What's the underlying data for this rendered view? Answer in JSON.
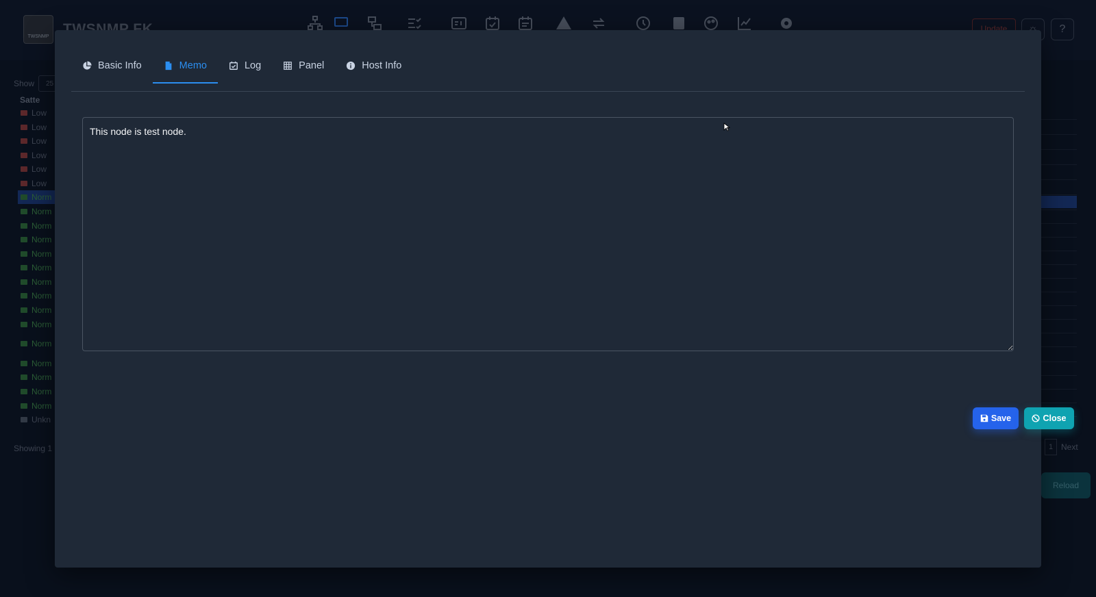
{
  "app": {
    "title": "TWSNMP FK",
    "logo_text": "TWSNMP",
    "update_label": "Update",
    "help_label": "?",
    "theme_label": "☼"
  },
  "nav_icons": [
    "network-map-icon",
    "node-list-icon",
    "lan-icon",
    "polling-list-icon",
    "address-icon",
    "event-log-icon",
    "syslog-icon",
    "alert-icon",
    "transfer-icon",
    "history-icon",
    "check-icon",
    "report-icon",
    "chart-icon",
    "settings-icon"
  ],
  "background_list": {
    "show_label": "Show",
    "show_value": "25",
    "state_header": "Satte",
    "rows": [
      {
        "label": "Low",
        "color": "#8b3a3a"
      },
      {
        "label": "Low",
        "color": "#8b3a3a"
      },
      {
        "label": "Low",
        "color": "#8b3a3a"
      },
      {
        "label": "Low",
        "color": "#8b3a3a"
      },
      {
        "label": "Low",
        "color": "#8b3a3a"
      },
      {
        "label": "Low",
        "color": "#8b3a3a"
      },
      {
        "label": "Norm",
        "color": "#2f6f3a"
      },
      {
        "label": "Norm",
        "color": "#2f6f3a"
      },
      {
        "label": "Norm",
        "color": "#2f6f3a"
      },
      {
        "label": "Norm",
        "color": "#2f6f3a"
      },
      {
        "label": "Norm",
        "color": "#2f6f3a"
      },
      {
        "label": "Norm",
        "color": "#2f6f3a"
      },
      {
        "label": "Norm",
        "color": "#2f6f3a"
      },
      {
        "label": "Norm",
        "color": "#2f6f3a"
      },
      {
        "label": "Norm",
        "color": "#2f6f3a"
      },
      {
        "label": "Norm",
        "color": "#2f6f3a"
      },
      {
        "label": "Norm",
        "color": "#2f6f3a"
      },
      {
        "label": "Norm",
        "color": "#2f6f3a"
      },
      {
        "label": "Norm",
        "color": "#2f6f3a"
      },
      {
        "label": "Norm",
        "color": "#2f6f3a"
      },
      {
        "label": "Norm",
        "color": "#2f6f3a"
      },
      {
        "label": "Unkn",
        "color": "#4b5563"
      }
    ],
    "showing_text": "Showing 1",
    "page_number": "1",
    "next_label": "Next",
    "reload_label": "Reload"
  },
  "modal": {
    "tabs": [
      {
        "label": "Basic Info",
        "icon": "pie-chart-icon",
        "active": false
      },
      {
        "label": "Memo",
        "icon": "document-icon",
        "active": true
      },
      {
        "label": "Log",
        "icon": "calendar-check-icon",
        "active": false
      },
      {
        "label": "Panel",
        "icon": "table-icon",
        "active": false
      },
      {
        "label": "Host Info",
        "icon": "info-icon",
        "active": false
      }
    ],
    "memo_text": "This node is test node.",
    "save_label": "Save",
    "close_label": "Close"
  },
  "colors": {
    "accent": "#2b8ef0",
    "save": "#2563eb",
    "close": "#0fa3b1",
    "modal_bg": "#1f2937"
  }
}
